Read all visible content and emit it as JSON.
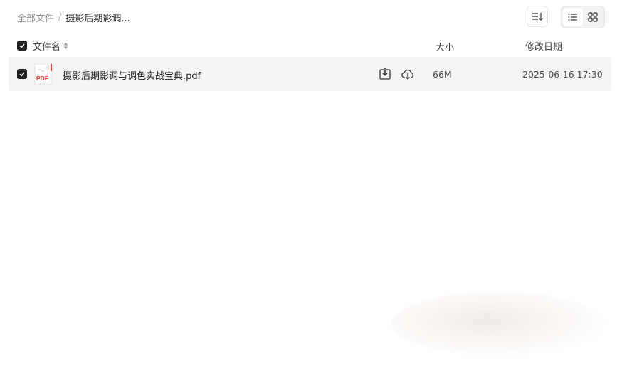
{
  "breadcrumb": {
    "root": "全部文件",
    "separator": "/",
    "current": "摄影后期影调..."
  },
  "toolbar": {
    "sort_icon": "sort-descending-icon",
    "list_view_icon": "list-view-icon",
    "grid_view_icon": "grid-view-icon",
    "active_view": "list"
  },
  "table": {
    "headers": {
      "name": "文件名",
      "size": "大小",
      "modified": "修改日期"
    },
    "rows": [
      {
        "checked": true,
        "icon": "pdf-file-icon",
        "icon_label": "PDF",
        "name": "摄影后期影调与调色实战宝典.pdf",
        "size": "66M",
        "modified": "2025-06-16 17:30"
      }
    ]
  },
  "colors": {
    "pdf_red": "#e53935",
    "row_bg": "#f4f4f4",
    "checkbox": "#1f1f1f"
  }
}
